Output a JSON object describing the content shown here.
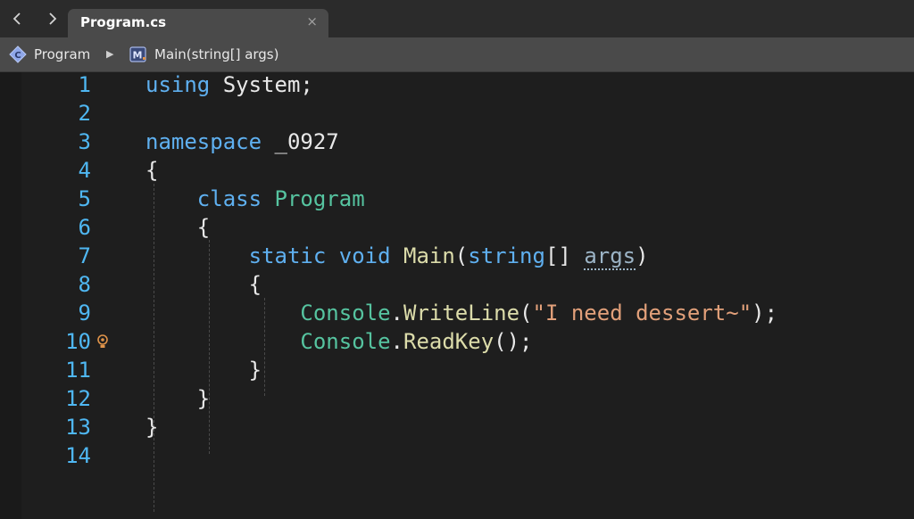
{
  "nav": {
    "back": "‹",
    "forward": "›"
  },
  "tab": {
    "title": "Program.cs",
    "close": "×"
  },
  "breadcrumb": {
    "class_icon_letter": "C",
    "class_name": "Program",
    "separator": "▶",
    "method_icon_letter": "M",
    "method_name": "Main(string[] args)"
  },
  "editor": {
    "lines": [
      {
        "number": "1",
        "tokens": [
          {
            "t": "using",
            "c": "kw"
          },
          {
            "t": " System;",
            "c": "plain"
          }
        ]
      },
      {
        "number": "2",
        "tokens": []
      },
      {
        "number": "3",
        "tokens": [
          {
            "t": "namespace",
            "c": "kw"
          },
          {
            "t": " _0927",
            "c": "plain"
          }
        ]
      },
      {
        "number": "4",
        "tokens": [
          {
            "t": "{",
            "c": "plain"
          }
        ]
      },
      {
        "number": "5",
        "tokens": [
          {
            "t": "    ",
            "c": "plain"
          },
          {
            "t": "class",
            "c": "kw"
          },
          {
            "t": " ",
            "c": "plain"
          },
          {
            "t": "Program",
            "c": "type"
          }
        ]
      },
      {
        "number": "6",
        "tokens": [
          {
            "t": "    {",
            "c": "plain"
          }
        ]
      },
      {
        "number": "7",
        "tokens": [
          {
            "t": "        ",
            "c": "plain"
          },
          {
            "t": "static",
            "c": "kw"
          },
          {
            "t": " ",
            "c": "plain"
          },
          {
            "t": "void",
            "c": "kw"
          },
          {
            "t": " ",
            "c": "plain"
          },
          {
            "t": "Main",
            "c": "method"
          },
          {
            "t": "(",
            "c": "plain"
          },
          {
            "t": "string",
            "c": "kw"
          },
          {
            "t": "[] ",
            "c": "plain"
          },
          {
            "t": "args",
            "c": "param"
          },
          {
            "t": ")",
            "c": "plain"
          }
        ]
      },
      {
        "number": "8",
        "tokens": [
          {
            "t": "        {",
            "c": "plain"
          }
        ]
      },
      {
        "number": "9",
        "tokens": [
          {
            "t": "            ",
            "c": "plain"
          },
          {
            "t": "Console",
            "c": "type"
          },
          {
            "t": ".",
            "c": "plain"
          },
          {
            "t": "WriteLine",
            "c": "method"
          },
          {
            "t": "(",
            "c": "plain"
          },
          {
            "t": "\"I need dessert~\"",
            "c": "str"
          },
          {
            "t": ");",
            "c": "plain"
          }
        ]
      },
      {
        "number": "10",
        "tokens": [
          {
            "t": "            ",
            "c": "plain"
          },
          {
            "t": "Console",
            "c": "type"
          },
          {
            "t": ".",
            "c": "plain"
          },
          {
            "t": "ReadKey",
            "c": "method"
          },
          {
            "t": "();",
            "c": "plain"
          }
        ],
        "bulb": true
      },
      {
        "number": "11",
        "tokens": [
          {
            "t": "        }",
            "c": "plain"
          }
        ]
      },
      {
        "number": "12",
        "tokens": [
          {
            "t": "    }",
            "c": "plain"
          }
        ]
      },
      {
        "number": "13",
        "tokens": [
          {
            "t": "}",
            "c": "plain"
          }
        ]
      },
      {
        "number": "14",
        "tokens": []
      }
    ]
  },
  "colors": {
    "keyword": "#5fb0f0",
    "type": "#56c4a0",
    "method": "#dcdcaa",
    "string": "#e2a07a",
    "line_number": "#4fb7f2",
    "bulb": "#e0944a"
  }
}
